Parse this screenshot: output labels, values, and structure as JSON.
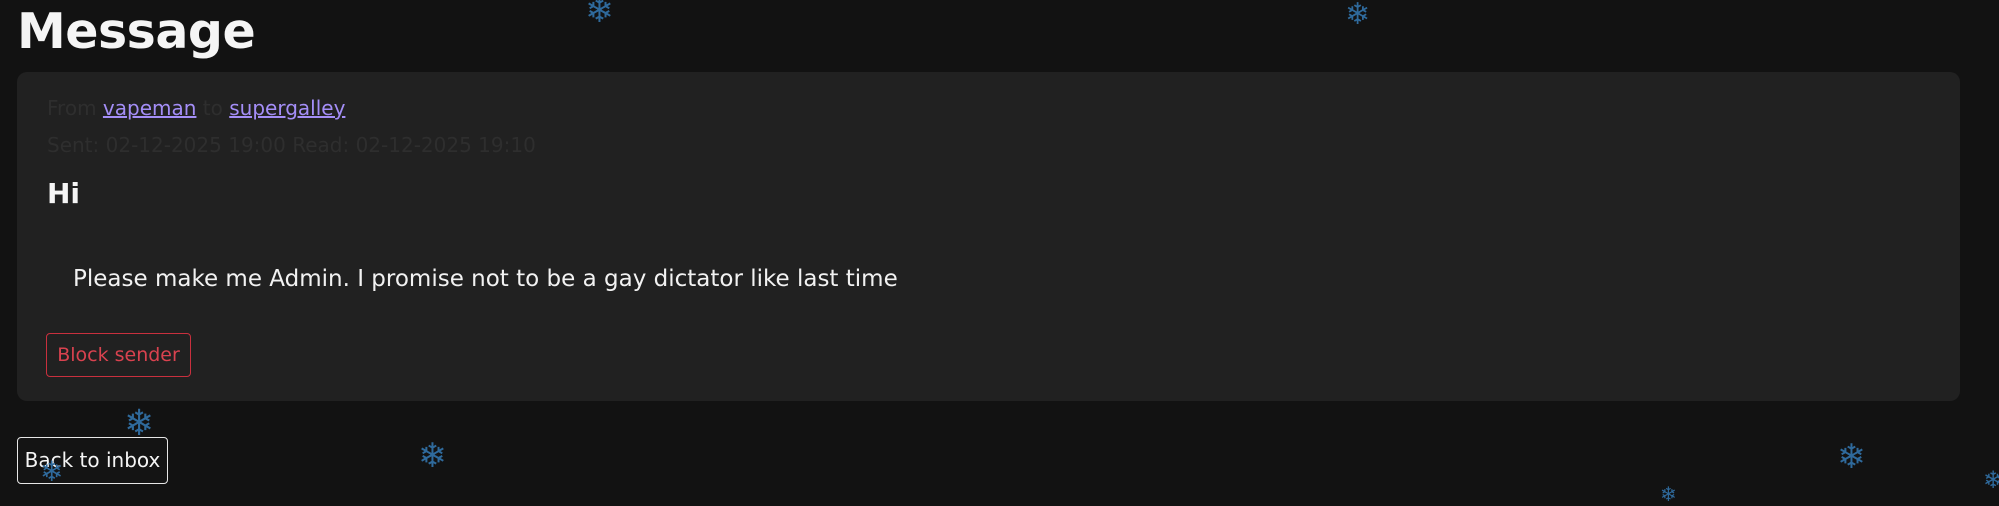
{
  "page": {
    "title": "Message"
  },
  "message": {
    "from_label": "From",
    "sender": "vapeman",
    "to_label": "to",
    "recipient": "supergalley",
    "sent_label": "Sent:",
    "sent_at": "02-12-2025 19:00",
    "read_label": "Read:",
    "read_at": "02-12-2025 19:10",
    "subject": "Hi",
    "body": "Please make me Admin. I promise not to be a gay dictator like last time"
  },
  "actions": {
    "block_label": "Block sender",
    "back_label": "Back to inbox"
  },
  "decorations": {
    "snowflake_glyph": "❄",
    "snowflake_icon": "snowflake-icon",
    "snowflake_color": "#2f6a9c"
  },
  "colors": {
    "background": "#121212",
    "card": "#212121",
    "link": "#a48ef7",
    "danger": "#c9303e"
  }
}
